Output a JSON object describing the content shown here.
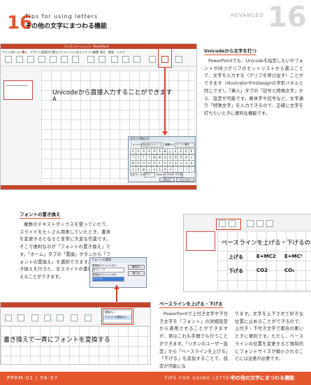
{
  "header": {
    "chapter_number": "16",
    "title_en": "Tips for using letters",
    "title_jp": "その他の文字にまつわる機能",
    "advanced_label": "ADVANCED",
    "advanced_number": "16"
  },
  "screenshot1": {
    "window_title": "プレゼンテーション1 - PowerPoint",
    "tabs": [
      "ファイル",
      "ホーム",
      "挿入",
      "デザイン",
      "画面切り替え",
      "アニメーション",
      "スライド ショー",
      "校閲",
      "表示",
      "開発",
      "ヘルプ"
    ],
    "slide_text": "Unicodeから直接入力することができます",
    "cursor_char": "A",
    "dialog_title": "記号と特殊文字",
    "dialog_font_label": "フォント(F):",
    "dialog_subset_label": "種類(U):",
    "dialog_font_value": "(現在選択されているフォント)",
    "dialog_subset_value": "ラテン1補助",
    "dialog_code_label": "文字コード(C):",
    "dialog_code_value": "00C1",
    "dialog_from_label": "from:",
    "dialog_from_value": "Unicode (16 進)",
    "dialog_chars": [
      "À",
      "Á",
      "Â",
      "Ã",
      "Ä",
      "Å",
      "Æ",
      "Ç",
      "È",
      "É",
      "Ê",
      "Ë",
      "Ì",
      "Í",
      "Î",
      "Ï",
      "Ð",
      "Ñ",
      "Ò",
      "Ó",
      "Ô",
      "Õ",
      "Ö",
      "×",
      "Ø",
      "Ù",
      "Ú",
      "Û",
      "Ü",
      "Ý",
      "Þ",
      "ß",
      "à",
      "á",
      "â",
      "ã",
      "ä",
      "å",
      "æ",
      "ç",
      "è",
      "é",
      "ê",
      "ë",
      "ì",
      "í",
      "î",
      "ï",
      "ð",
      "ñ",
      "ò",
      "ó",
      "ô",
      "õ",
      "ö",
      "÷",
      "ø",
      "ù",
      "ú",
      "û",
      "ü",
      "ý",
      "þ",
      "ÿ"
    ],
    "dialog_insert": "挿入(I)",
    "dialog_cancel": "キャンセル"
  },
  "section_unicode": {
    "title": "Unicodeから文字を打つ",
    "body": "PowerPointでも、Unicodeを指定したいやフォントが持つグリフのセットリストから選ぶことで、文字を入力する（グリフを呼び出す）ことができます（IllustratorやInDesignの字形パネルと同じです）。「挿入」タブの「記号と特殊文字」から、設定が可能です。異体字や記号など、文字通り「特殊文字」を入力できるので、正確に文字を打ちたいときに便利な機能です。"
  },
  "section_replace": {
    "title": "フォントの置き換え",
    "body": "複数のテキストボックスを使っていたり、スライドをたくさん用意していたとき、書体を変更するとなると非常に大変な作業です。そこで便利なのが「フォントの置き換え」です。「ホーム」タブの「置換」ボタンから「フォントの置換え」を選択できます。ここで置き換えを行うと、全スライドの書体を置き換えることができます。"
  },
  "screenshot2": {
    "slide_text": "ベースラインを上げる・下げるの機能",
    "row1_label": "上げる",
    "row1_a": "E=MC2",
    "row1_b": "E=MC²",
    "row2_label": "下げる",
    "row2_a": "CO2",
    "row2_b": "CO₂"
  },
  "screenshot3": {
    "dialog_title": "フォントの置換",
    "replace_label": "置換前のフォント(P):",
    "replace_value": "游ゴシック",
    "with_label": "置換後のフォント(W):",
    "with_value": "メイリオ",
    "replace_button": "置換(R)",
    "close_button": "閉じる"
  },
  "screenshot4": {
    "slide_text": "書き換えで一斉にフォントを変換する",
    "menu_items": [
      "置換(R)...",
      "フォントの置換(O)..."
    ]
  },
  "section_baseline": {
    "title": "ベースラインを上げる・下げる",
    "body_left": "PowerPointで上付き文字や下付き文字を「フォント」の詳細設定から適用させることができますが、実はこれも手間でも行うことができます。「リボンのユーザー設定」から「ベースラインを上げる」「下げる」を追加することで、設定が可能にな",
    "body_right": "ります。文字を上下させて好きな位置に止めることができるので、上付き・下付き文字で都合の悪いときに便利です。ただし、ベースラインの位置を変更すると強制的にフォントサイズが縮小されることには注意が必要です。"
  },
  "footer": {
    "page_label": "PPRM-01 | 56-57",
    "section_en": "TIPS FOR USING LETTERS",
    "section_jp": "その他の文字にまつわる機能"
  },
  "colors": {
    "accent": "#e4572e",
    "ribbon": "#c5452b",
    "callout": "#d9412b"
  }
}
